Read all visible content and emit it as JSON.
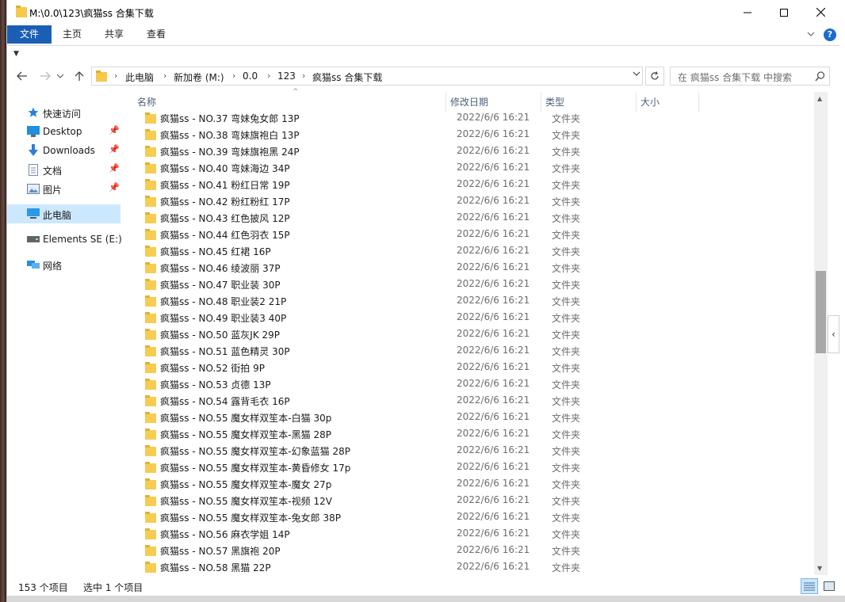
{
  "window": {
    "title": "M:\\0.0\\123\\疯猫ss 合集下载"
  },
  "ribbon": {
    "tabs": [
      "文件",
      "主页",
      "共享",
      "查看"
    ]
  },
  "address": {
    "crumbs": [
      "此电脑",
      "新加卷 (M:)",
      "0.0",
      "123",
      "疯猫ss 合集下载"
    ]
  },
  "search": {
    "placeholder": "在 疯猫ss 合集下载 中搜索"
  },
  "navpane": {
    "quick_access": "快速访问",
    "items": [
      {
        "label": "Desktop",
        "icon": "desktop-icon"
      },
      {
        "label": "Downloads",
        "icon": "download-icon"
      },
      {
        "label": "文档",
        "icon": "document-icon"
      },
      {
        "label": "图片",
        "icon": "picture-icon"
      }
    ],
    "this_pc": "此电脑",
    "drive": "Elements SE (E:)",
    "network": "网络"
  },
  "columns": {
    "name": "名称",
    "date": "修改日期",
    "type": "类型",
    "size": "大小"
  },
  "files": [
    {
      "name": "疯猫ss - NO.37 弯妹兔女郎 13P",
      "date": "2022/6/6 16:21",
      "type": "文件夹"
    },
    {
      "name": "疯猫ss - NO.38 弯妹旗袍白 13P",
      "date": "2022/6/6 16:21",
      "type": "文件夹"
    },
    {
      "name": "疯猫ss - NO.39 弯妹旗袍黑 24P",
      "date": "2022/6/6 16:21",
      "type": "文件夹"
    },
    {
      "name": "疯猫ss - NO.40 弯妹海边 34P",
      "date": "2022/6/6 16:21",
      "type": "文件夹"
    },
    {
      "name": "疯猫ss - NO.41 粉红日常 19P",
      "date": "2022/6/6 16:21",
      "type": "文件夹"
    },
    {
      "name": "疯猫ss - NO.42 粉红粉红 17P",
      "date": "2022/6/6 16:21",
      "type": "文件夹"
    },
    {
      "name": "疯猫ss - NO.43 红色披风 12P",
      "date": "2022/6/6 16:21",
      "type": "文件夹"
    },
    {
      "name": "疯猫ss - NO.44 红色羽衣 15P",
      "date": "2022/6/6 16:21",
      "type": "文件夹"
    },
    {
      "name": "疯猫ss - NO.45 红裙 16P",
      "date": "2022/6/6 16:21",
      "type": "文件夹"
    },
    {
      "name": "疯猫ss - NO.46 绫波丽 37P",
      "date": "2022/6/6 16:21",
      "type": "文件夹"
    },
    {
      "name": "疯猫ss - NO.47 职业装 30P",
      "date": "2022/6/6 16:21",
      "type": "文件夹"
    },
    {
      "name": "疯猫ss - NO.48 职业装2 21P",
      "date": "2022/6/6 16:21",
      "type": "文件夹"
    },
    {
      "name": "疯猫ss - NO.49 职业装3 40P",
      "date": "2022/6/6 16:21",
      "type": "文件夹"
    },
    {
      "name": "疯猫ss - NO.50 蓝灰JK 29P",
      "date": "2022/6/6 16:21",
      "type": "文件夹"
    },
    {
      "name": "疯猫ss - NO.51 蓝色精灵 30P",
      "date": "2022/6/6 16:21",
      "type": "文件夹"
    },
    {
      "name": "疯猫ss - NO.52 街拍 9P",
      "date": "2022/6/6 16:21",
      "type": "文件夹"
    },
    {
      "name": "疯猫ss - NO.53 贞德 13P",
      "date": "2022/6/6 16:21",
      "type": "文件夹"
    },
    {
      "name": "疯猫ss - NO.54 露背毛衣 16P",
      "date": "2022/6/6 16:21",
      "type": "文件夹"
    },
    {
      "name": "疯猫ss - NO.55 魔女样双笙本-白猫 30p",
      "date": "2022/6/6 16:21",
      "type": "文件夹"
    },
    {
      "name": "疯猫ss - NO.55 魔女样双笙本-黑猫 28P",
      "date": "2022/6/6 16:21",
      "type": "文件夹"
    },
    {
      "name": "疯猫ss - NO.55 魔女样双笙本-幻象蓝猫 28P",
      "date": "2022/6/6 16:21",
      "type": "文件夹"
    },
    {
      "name": "疯猫ss - NO.55 魔女样双笙本-黄昏修女 17p",
      "date": "2022/6/6 16:21",
      "type": "文件夹"
    },
    {
      "name": "疯猫ss - NO.55 魔女样双笙本-魔女 27p",
      "date": "2022/6/6 16:21",
      "type": "文件夹"
    },
    {
      "name": "疯猫ss - NO.55 魔女样双笙本-视频 12V",
      "date": "2022/6/6 16:21",
      "type": "文件夹"
    },
    {
      "name": "疯猫ss - NO.55 魔女样双笙本-兔女郎 38P",
      "date": "2022/6/6 16:21",
      "type": "文件夹"
    },
    {
      "name": "疯猫ss - NO.56 麻衣学姐 14P",
      "date": "2022/6/6 16:21",
      "type": "文件夹"
    },
    {
      "name": "疯猫ss - NO.57 黑旗袍 20P",
      "date": "2022/6/6 16:21",
      "type": "文件夹"
    },
    {
      "name": "疯猫ss - NO.58 黑猫 22P",
      "date": "2022/6/6 16:21",
      "type": "文件夹"
    }
  ],
  "status": {
    "count": "153 个项目",
    "selected": "选中 1 个项目"
  }
}
